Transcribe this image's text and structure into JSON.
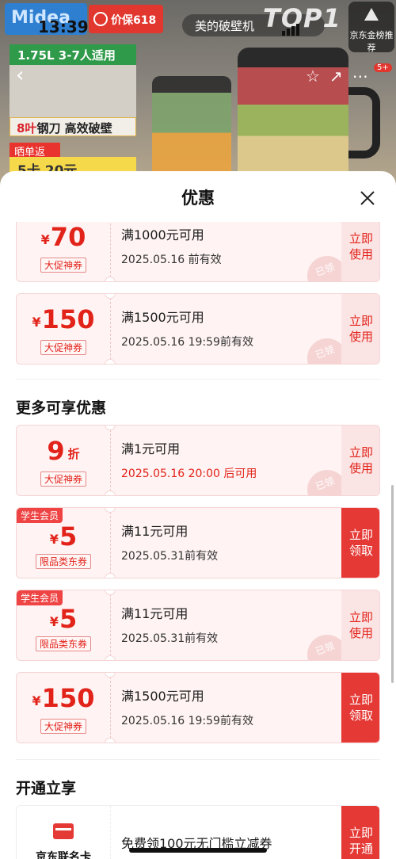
{
  "background_page": {
    "brand": "Midea",
    "promo": "价保618",
    "rank_pill": "美的破壁机",
    "rank_top": "TOP1",
    "jd_badge": "京东金榜推荐",
    "status_time": "13:39",
    "capacity": "1.75L 3-7人适用",
    "blade_prefix": "8叶",
    "blade_text": "钢刀 高效破壁",
    "shaidan": "晒单返",
    "gift": "5卡 20元",
    "cart_count": "5+"
  },
  "sheet": {
    "title": "优惠"
  },
  "coupons_top": [
    {
      "currency": "¥",
      "amount": "70",
      "tag": "大促神券",
      "condition": "满1000元可用",
      "date": "2025.05.16 前有效",
      "action": "立即\n使用",
      "stamp": "已领"
    },
    {
      "currency": "¥",
      "amount": "150",
      "tag": "大促神券",
      "condition": "满1500元可用",
      "date": "2025.05.16 19:59前有效",
      "action": "立即\n使用",
      "stamp": "已领"
    }
  ],
  "more_section": {
    "title": "更多可享优惠",
    "coupons": [
      {
        "amount": "9",
        "unit": "折",
        "tag": "大促神券",
        "condition": "满1元可用",
        "date": "2025.05.16 20:00 后可用",
        "action": "立即\n使用",
        "stamp": "已领"
      },
      {
        "member": "学生会员",
        "currency": "¥",
        "amount": "5",
        "tag": "限品类东券",
        "condition": "满11元可用",
        "date": "2025.05.31前有效",
        "action": "立即\n领取"
      },
      {
        "member": "学生会员",
        "currency": "¥",
        "amount": "5",
        "tag": "限品类东券",
        "condition": "满11元可用",
        "date": "2025.05.31前有效",
        "action": "立即\n使用",
        "stamp": "已领"
      },
      {
        "currency": "¥",
        "amount": "150",
        "tag": "大促神券",
        "condition": "满1500元可用",
        "date": "2025.05.16 19:59前有效",
        "action": "立即\n领取"
      }
    ]
  },
  "open_section": {
    "title": "开通立享",
    "card_name": "京东联名卡",
    "offer": "免费领100元无门槛立减券",
    "action": "立即\n开通"
  }
}
